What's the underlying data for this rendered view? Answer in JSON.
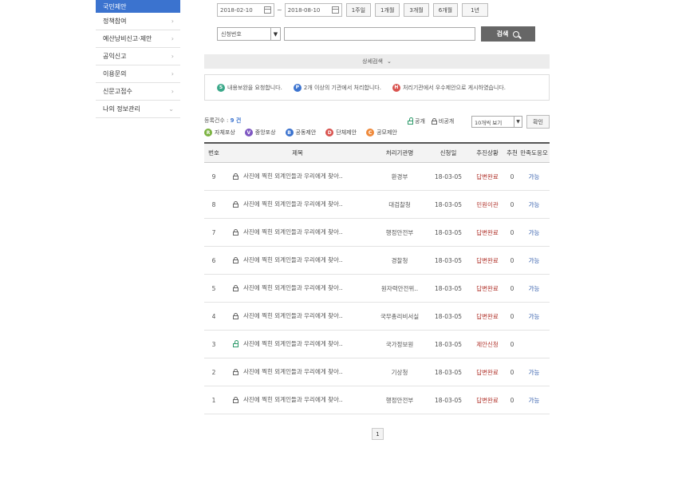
{
  "sidebar": {
    "items": [
      {
        "label": "국민제안",
        "active": true
      },
      {
        "label": "정책참여"
      },
      {
        "label": "예산낭비신고·제안"
      },
      {
        "label": "공익신고"
      },
      {
        "label": "이용문의"
      },
      {
        "label": "신문고접수"
      },
      {
        "label": "나의 정보관리"
      }
    ]
  },
  "search": {
    "date_from": "2018-02-10",
    "tilde": "~",
    "date_to": "2018-08-10",
    "periods": [
      "1주일",
      "1개월",
      "3개월",
      "6개월",
      "1년"
    ],
    "select_value": "신청번호",
    "search_label": "검색",
    "detail_label": "상세검색"
  },
  "notice": {
    "items": [
      {
        "badge": "S",
        "color": "#3aa889",
        "text": "내용보완을 요청합니다."
      },
      {
        "badge": "P",
        "color": "#3b73cf",
        "text": "2개 이상의 기관에서 처리합니다."
      },
      {
        "badge": "H",
        "color": "#d9534f",
        "text": "처리기관에서 우수제안으로 게시하였습니다."
      }
    ]
  },
  "list": {
    "count_label": "등록건수 :",
    "count_value": "9 건",
    "public_label": "공개",
    "private_label": "비공개",
    "per_page": "10개씩 보기",
    "ok_label": "확인",
    "types": [
      {
        "badge": "R",
        "color": "#7cb342",
        "label": "자체포상"
      },
      {
        "badge": "V",
        "color": "#7e57c2",
        "label": "중앙포상"
      },
      {
        "badge": "B",
        "color": "#3b73cf",
        "label": "공동제안"
      },
      {
        "badge": "D",
        "color": "#d9534f",
        "label": "단체제안"
      },
      {
        "badge": "C",
        "color": "#ef8a3c",
        "label": "공모제안"
      }
    ]
  },
  "table": {
    "headers": {
      "no": "번호",
      "title": "제목",
      "org": "처리기관명",
      "date": "신청일",
      "status": "추진상황",
      "rec": "추천",
      "sat": "만족도응오"
    },
    "rows": [
      {
        "no": "9",
        "title": "사진에 찍힌 외계인들과 우리에게 찾아..",
        "org": "환경부",
        "date": "18-03-05",
        "status": "답변완료",
        "rec": "0",
        "sat": "가능",
        "locked": true
      },
      {
        "no": "8",
        "title": "사진에 찍힌 외계인들과 우리에게 찾아..",
        "org": "대검찰청",
        "date": "18-03-05",
        "status": "민원이관",
        "rec": "0",
        "sat": "가능",
        "locked": true
      },
      {
        "no": "7",
        "title": "사진에 찍힌 외계인들과 우리에게 찾아..",
        "org": "행정안전부",
        "date": "18-03-05",
        "status": "답변완료",
        "rec": "0",
        "sat": "가능",
        "locked": true
      },
      {
        "no": "6",
        "title": "사진에 찍힌 외계인들과 우리에게 찾아..",
        "org": "경찰청",
        "date": "18-03-05",
        "status": "답변완료",
        "rec": "0",
        "sat": "가능",
        "locked": true
      },
      {
        "no": "5",
        "title": "사진에 찍힌 외계인들과 우리에게 찾아..",
        "org": "원자력안전위..",
        "date": "18-03-05",
        "status": "답변완료",
        "rec": "0",
        "sat": "가능",
        "locked": true
      },
      {
        "no": "4",
        "title": "사진에 찍힌 외계인들과 우리에게 찾아..",
        "org": "국무총리비서실",
        "date": "18-03-05",
        "status": "답변완료",
        "rec": "0",
        "sat": "가능",
        "locked": true
      },
      {
        "no": "3",
        "title": "사진에 찍힌 외계인들과 우리에게 찾아..",
        "org": "국가정보원",
        "date": "18-03-05",
        "status": "제안신청",
        "rec": "0",
        "sat": "",
        "locked": false
      },
      {
        "no": "2",
        "title": "사진에 찍힌 외계인들과 우리에게 찾아..",
        "org": "기상청",
        "date": "18-03-05",
        "status": "답변완료",
        "rec": "0",
        "sat": "가능",
        "locked": true
      },
      {
        "no": "1",
        "title": "사진에 찍힌 외계인들과 우리에게 찾아..",
        "org": "행정안전부",
        "date": "18-03-05",
        "status": "답변완료",
        "rec": "0",
        "sat": "가능",
        "locked": true
      }
    ]
  },
  "pagination": {
    "current": "1"
  }
}
